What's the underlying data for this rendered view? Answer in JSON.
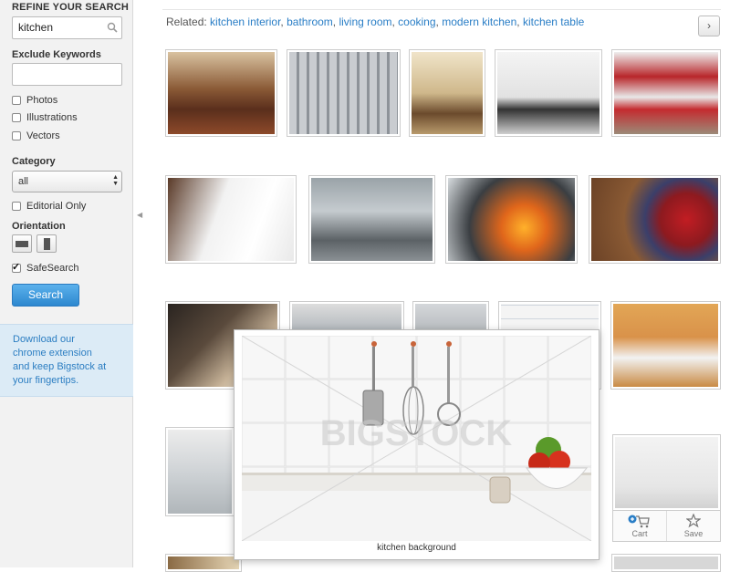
{
  "sidebar": {
    "title": "REFINE YOUR SEARCH",
    "search_value": "kitchen",
    "exclude_label": "Exclude Keywords",
    "exclude_value": "",
    "types": [
      "Photos",
      "Illustrations",
      "Vectors"
    ],
    "category_label": "Category",
    "category_value": "all",
    "editorial_label": "Editorial Only",
    "orientation_label": "Orientation",
    "safesearch_label": "SafeSearch",
    "search_button": "Search",
    "promo_line1": "Download our",
    "promo_line2": "chrome extension",
    "promo_line3": "and keep Bigstock at",
    "promo_line4": "your fingertips."
  },
  "related": {
    "label": "Related:",
    "links": [
      "kitchen interior",
      "bathroom",
      "living room",
      "cooking",
      "modern kitchen",
      "kitchen table"
    ]
  },
  "popup": {
    "watermark": "BIGSTOCK",
    "caption": "kitchen background"
  },
  "card": {
    "cart_label": "Cart",
    "save_label": "Save"
  },
  "colors": {
    "link": "#2a7ec6",
    "search_button": "#3a95da",
    "promo_bg": "#dcebf6"
  }
}
